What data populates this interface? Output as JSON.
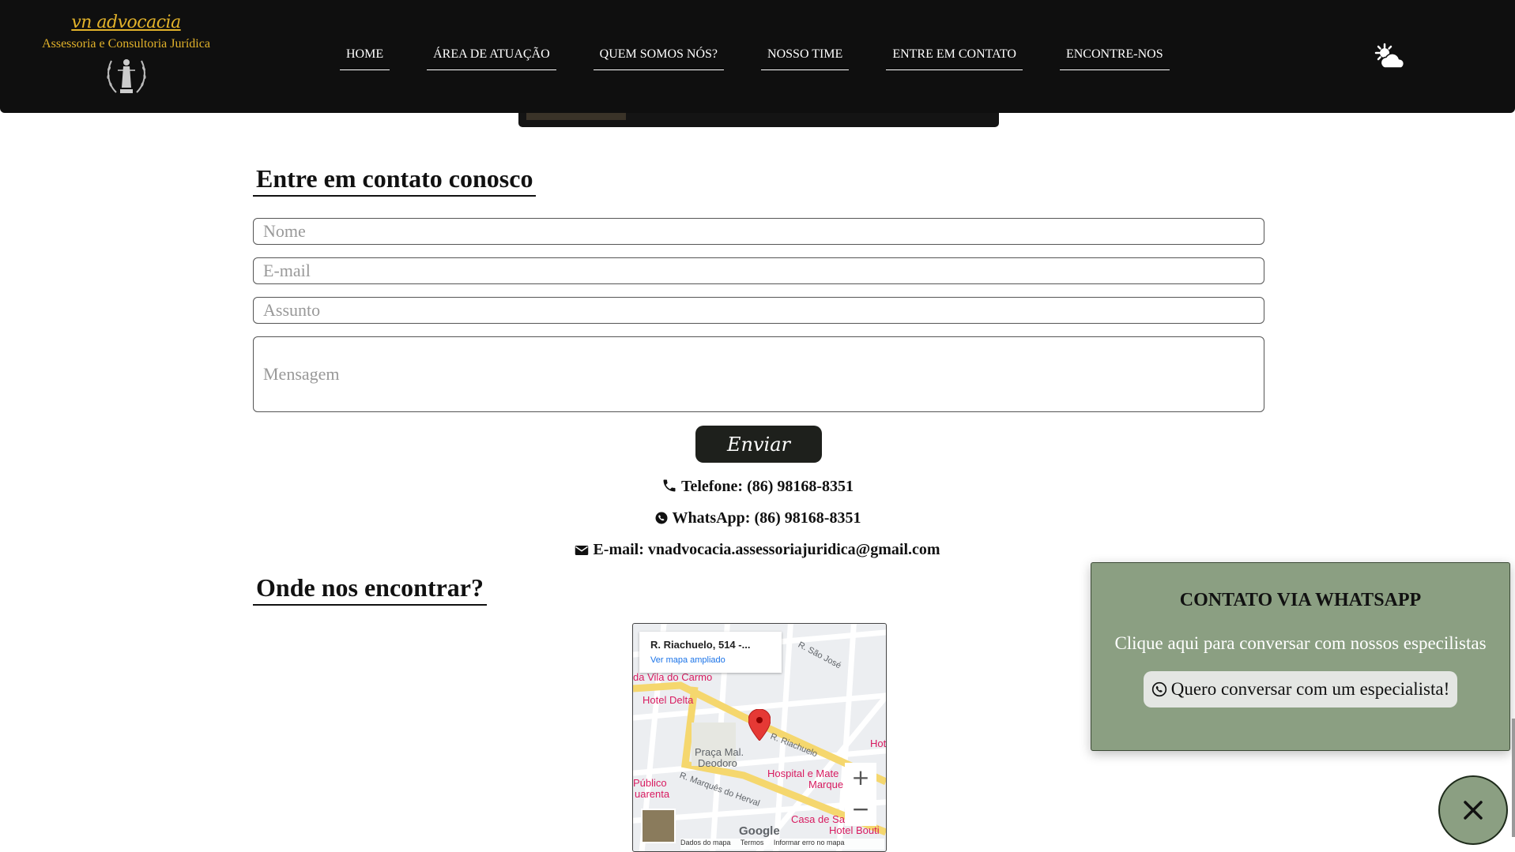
{
  "header": {
    "logo": {
      "name": "vn advocacia",
      "tagline": "Assessoria e Consultoria Jurídica",
      "emblem_icon": "justice-statue-laurel"
    },
    "nav": [
      {
        "label": "HOME"
      },
      {
        "label": "ÁREA DE ATUAÇÃO"
      },
      {
        "label": "QUEM SOMOS NÓS?"
      },
      {
        "label": "NOSSO TIME"
      },
      {
        "label": "ENTRE EM CONTATO"
      },
      {
        "label": "ENCONTRE-NOS"
      }
    ],
    "theme_toggle_icon": "weather-sun-cloud-icon"
  },
  "contact": {
    "title": "Entre em contato conosco",
    "fields": {
      "name_placeholder": "Nome",
      "email_placeholder": "E-mail",
      "subject_placeholder": "Assunto",
      "message_placeholder": "Mensagem"
    },
    "send_label": "Enviar",
    "phone": "Telefone: (86) 98168-8351",
    "whatsapp": "WhatsApp: (86) 98168-8351",
    "email": "E-mail: vnadvocacia.assessoriajuridica@gmail.com"
  },
  "location": {
    "title": "Onde nos encontrar?",
    "map": {
      "address": "R. Riachuelo, 514 -...",
      "enlarge_link": "Ver mapa ampliado",
      "labels": {
        "vila": "da Vila do Carmo",
        "hotel_delta": "Hotel Delta",
        "praca": "Praça Mal.",
        "praca2": "Deodoro",
        "riachuelo": "R. Riachuelo",
        "sao_jose": "R. São José",
        "hospital": "Hospital e Mate",
        "hospital2": "Marque",
        "publico": "Público",
        "publico2": "uarenta",
        "marques": "R. Marquês do Herval",
        "casa": "Casa de Sa",
        "hotel_bout": "Hotel Bouti",
        "hot": "Hot"
      },
      "zoom_in": "+",
      "zoom_out": "−",
      "google": "Google",
      "footer": {
        "data": "Dados do mapa",
        "terms": "Termos",
        "report": "Informar erro no mapa"
      }
    }
  },
  "whatsapp_popup": {
    "title": "CONTATO VIA WHATSAPP",
    "text": "Clique aqui para conversar com nossos especilistas",
    "button": "Quero conversar com um especialista!",
    "close_icon": "close-icon"
  },
  "colors": {
    "header_bg": "#0f0f0f",
    "brand_gold": "#e2b22a",
    "popup_green": "#8b9f82",
    "button_dark": "#1e201c"
  }
}
